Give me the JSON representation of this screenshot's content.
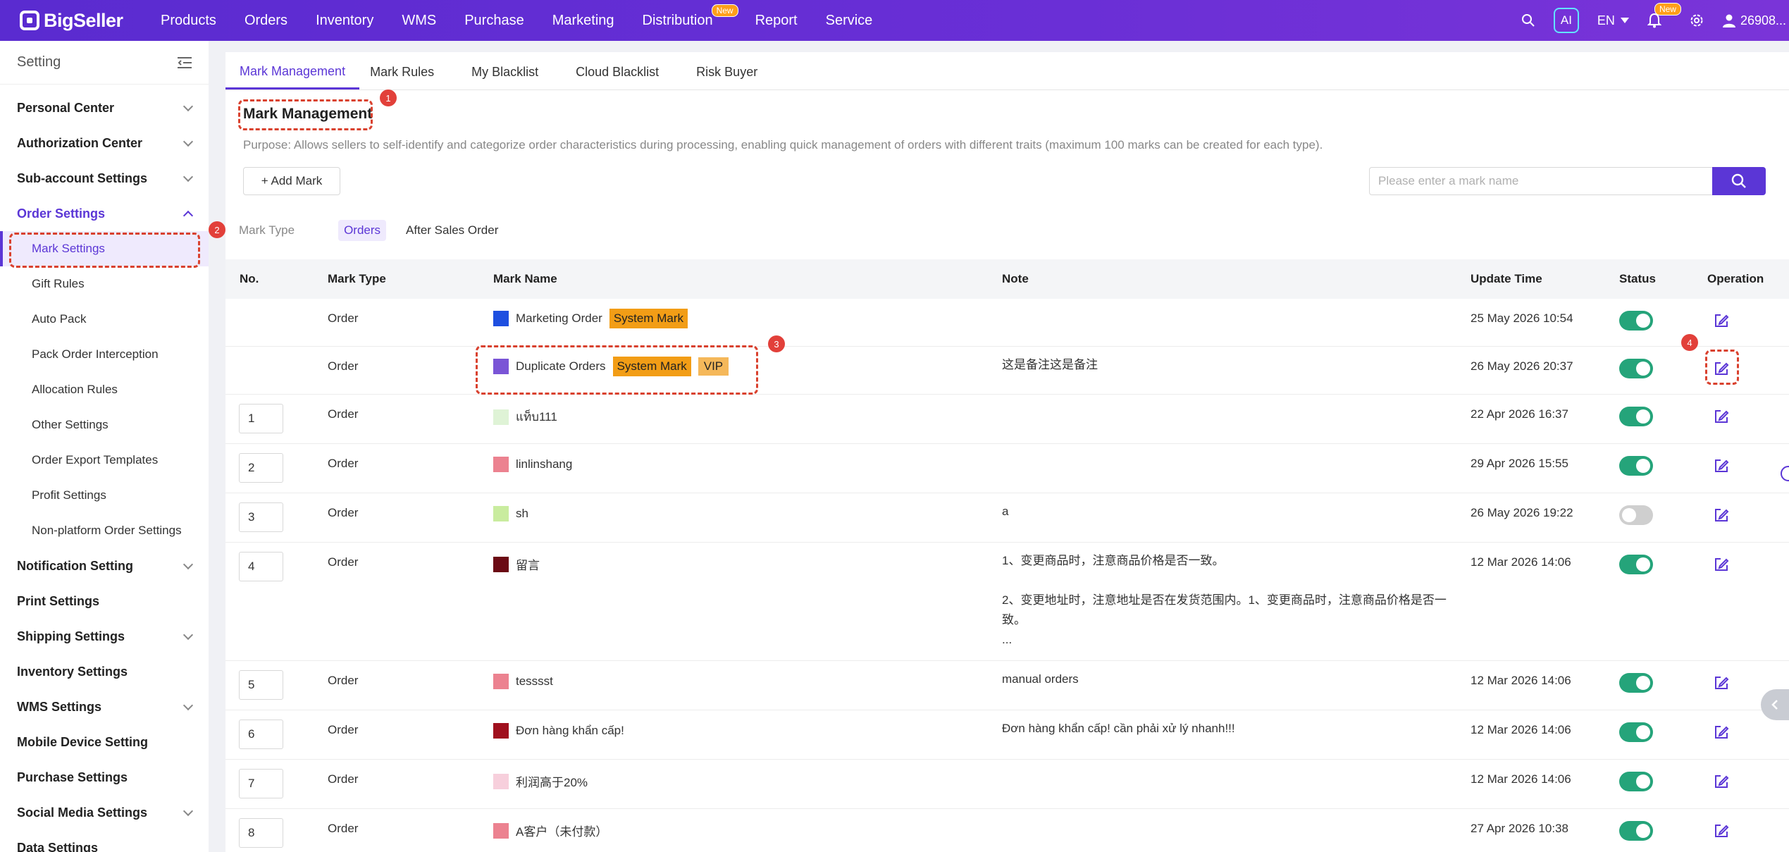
{
  "brand": {
    "name": "BigSeller",
    "accent": "#5b36d6",
    "toggle_on": "#25a47a",
    "annotation": "#d9412e"
  },
  "topnav": {
    "items": [
      "Products",
      "Orders",
      "Inventory",
      "WMS",
      "Purchase",
      "Marketing",
      "Distribution",
      "Report",
      "Service"
    ],
    "distribution_badge": "New",
    "ai_label": "AI",
    "language": "EN",
    "notification_badge": "New",
    "user": "26908..."
  },
  "sidebar": {
    "title": "Setting",
    "groups": [
      {
        "label": "Personal Center"
      },
      {
        "label": "Authorization Center"
      },
      {
        "label": "Sub-account Settings"
      },
      {
        "label": "Order Settings"
      }
    ],
    "order_subitems": [
      "Mark Settings",
      "Gift Rules",
      "Auto Pack",
      "Pack Order Interception",
      "Allocation Rules",
      "Other Settings",
      "Order Export Templates",
      "Profit Settings",
      "Non-platform Order Settings"
    ],
    "groups_after": [
      "Notification Setting",
      "Print Settings",
      "Shipping Settings",
      "Inventory Settings",
      "WMS Settings",
      "Mobile Device Setting",
      "Purchase Settings",
      "Social Media Settings",
      "Data Settings"
    ]
  },
  "tabs": [
    "Mark Management",
    "Mark Rules",
    "My Blacklist",
    "Cloud Blacklist",
    "Risk Buyer"
  ],
  "page": {
    "title": "Mark Management",
    "purpose": "Purpose: Allows sellers to self-identify and categorize order characteristics during processing, enabling quick management of orders with different traits (maximum 100 marks can be created for each type).",
    "add_button": "+ Add Mark",
    "search_placeholder": "Please enter a mark name",
    "mark_type_label": "Mark Type",
    "mark_types": [
      "Orders",
      "After Sales Order"
    ]
  },
  "table": {
    "headers": {
      "no": "No.",
      "type": "Mark Type",
      "name": "Mark Name",
      "note": "Note",
      "time": "Update Time",
      "status": "Status",
      "op": "Operation"
    },
    "rows": [
      {
        "no": "",
        "type": "Order",
        "name": "Marketing Order",
        "color": "#1e4fe0",
        "tags": [
          "System Mark"
        ],
        "note": "",
        "time": "25 May 2026 10:54",
        "on": true
      },
      {
        "no": "",
        "type": "Order",
        "name": "Duplicate Orders",
        "color": "#7a55d6",
        "tags": [
          "System Mark",
          "VIP"
        ],
        "note": "这是备注这是备注",
        "time": "26 May 2026 20:37",
        "on": true
      },
      {
        "no": "1",
        "type": "Order",
        "name": "แท็บ111",
        "color": "#dff3d6",
        "tags": [],
        "note": "",
        "time": "22 Apr 2026 16:37",
        "on": true
      },
      {
        "no": "2",
        "type": "Order",
        "name": "linlinshang",
        "color": "#ec8290",
        "tags": [],
        "note": "",
        "time": "29 Apr 2026 15:55",
        "on": true
      },
      {
        "no": "3",
        "type": "Order",
        "name": "sh",
        "color": "#c9ec9f",
        "tags": [],
        "note": "a",
        "time": "26 May 2026 19:22",
        "on": false
      },
      {
        "no": "4",
        "type": "Order",
        "name": "留言",
        "color": "#6b0a14",
        "tags": [],
        "note": "1、变更商品时，注意商品价格是否一致。\n\n2、变更地址时，注意地址是否在发货范围内。1、变更商品时，注意商品价格是否一致。\n...",
        "time": "12 Mar 2026 14:06",
        "on": true
      },
      {
        "no": "5",
        "type": "Order",
        "name": "tesssst",
        "color": "#ec8290",
        "tags": [],
        "note": "manual orders",
        "time": "12 Mar 2026 14:06",
        "on": true
      },
      {
        "no": "6",
        "type": "Order",
        "name": "Đơn hàng khẩn cấp!",
        "color": "#a0101e",
        "tags": [],
        "note": "Đơn hàng khẩn cấp! cần phải xử lý nhanh!!!",
        "time": "12 Mar 2026 14:06",
        "on": true
      },
      {
        "no": "7",
        "type": "Order",
        "name": "利润高于20%",
        "color": "#f7cfdc",
        "tags": [],
        "note": "",
        "time": "12 Mar 2026 14:06",
        "on": true
      },
      {
        "no": "8",
        "type": "Order",
        "name": "A客户（未付款）",
        "color": "#ec8290",
        "tags": [],
        "note": "",
        "time": "27 Apr 2026 10:38",
        "on": true
      }
    ]
  },
  "annotations": [
    "1",
    "2",
    "3",
    "4"
  ]
}
